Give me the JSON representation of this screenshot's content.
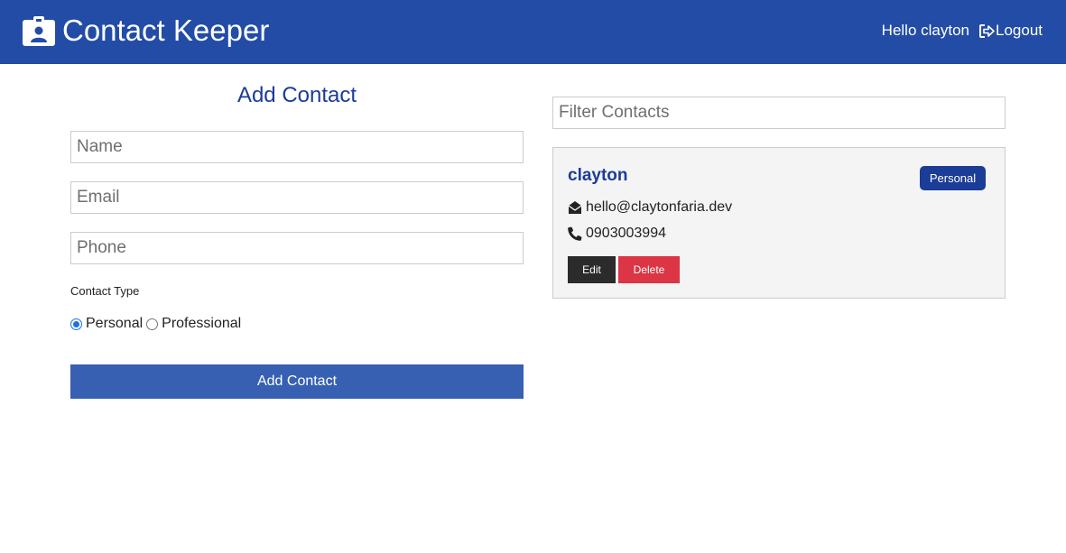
{
  "app": {
    "title": "Contact Keeper",
    "brand_icon": "id-badge-icon",
    "greeting": "Hello clayton",
    "logout_label": "Logout",
    "logout_icon": "sign-out-icon",
    "colors": {
      "navbar": "#224ca6",
      "primary": "#1b3c97",
      "button": "#3760b3",
      "danger": "#dc3545",
      "dark": "#2b2b2b"
    }
  },
  "form": {
    "title": "Add Contact",
    "name_placeholder": "Name",
    "email_placeholder": "Email",
    "phone_placeholder": "Phone",
    "type_label": "Contact Type",
    "radio_options": [
      {
        "label": "Personal",
        "checked": true
      },
      {
        "label": "Professional",
        "checked": false
      }
    ],
    "submit_label": "Add Contact"
  },
  "filter": {
    "placeholder": "Filter Contacts"
  },
  "contacts": [
    {
      "name": "clayton",
      "type": "Personal",
      "email": "hello@claytonfaria.dev",
      "email_icon": "envelope-open-icon",
      "phone": "0903003994",
      "phone_icon": "phone-icon",
      "edit_label": "Edit",
      "delete_label": "Delete"
    }
  ]
}
